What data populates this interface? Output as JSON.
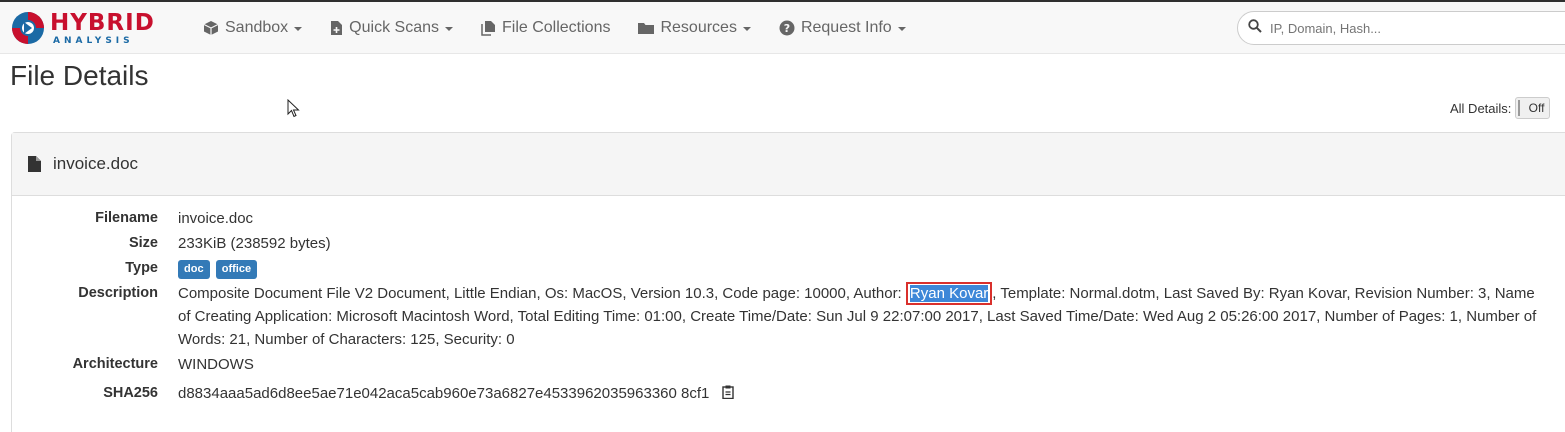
{
  "brand": {
    "name_top": "HYBRID",
    "name_bottom": "ANALYSIS"
  },
  "nav": [
    {
      "label": "Sandbox",
      "icon": "cube-icon",
      "dropdown": true
    },
    {
      "label": "Quick Scans",
      "icon": "file-plus-icon",
      "dropdown": true
    },
    {
      "label": "File Collections",
      "icon": "files-icon",
      "dropdown": false
    },
    {
      "label": "Resources",
      "icon": "folder-icon",
      "dropdown": true
    },
    {
      "label": "Request Info",
      "icon": "question-circle-icon",
      "dropdown": true
    }
  ],
  "search": {
    "placeholder": "IP, Domain, Hash..."
  },
  "page": {
    "title": "File Details",
    "all_details_label": "All Details:",
    "all_details_state": "Off"
  },
  "file": {
    "heading": "invoice.doc",
    "rows": {
      "filename": {
        "label": "Filename",
        "value": "invoice.doc"
      },
      "size": {
        "label": "Size",
        "value": "233KiB (238592 bytes)"
      },
      "type": {
        "label": "Type",
        "tags": [
          "doc",
          "office"
        ]
      },
      "description": {
        "label": "Description",
        "before": "Composite Document File V2 Document, Little Endian, Os: MacOS, Version 10.3, Code page: 10000, Author: ",
        "highlight": "Ryan Kovar",
        "after": ", Template: Normal.dotm, Last Saved By: Ryan Kovar, Revision Number: 3, Name of Creating Application: Microsoft Macintosh Word, Total Editing Time: 01:00, Create Time/Date: Sun Jul 9 22:07:00 2017, Last Saved Time/Date: Wed Aug 2 05:26:00 2017, Number of Pages: 1, Number of Words: 21, Number of Characters: 125, Security: 0"
      },
      "architecture": {
        "label": "Architecture",
        "value": "WINDOWS"
      },
      "sha256": {
        "label": "SHA256",
        "value": "d8834aaa5ad6d8ee5ae71e042aca5cab960e73a6827e4533962035963360 8cf1"
      }
    }
  },
  "colors": {
    "brand_red": "#c8102e",
    "brand_blue": "#1b6aa5",
    "tag_blue": "#337ab7",
    "highlight_border": "#d9302c",
    "selection": "#3d87d8"
  }
}
